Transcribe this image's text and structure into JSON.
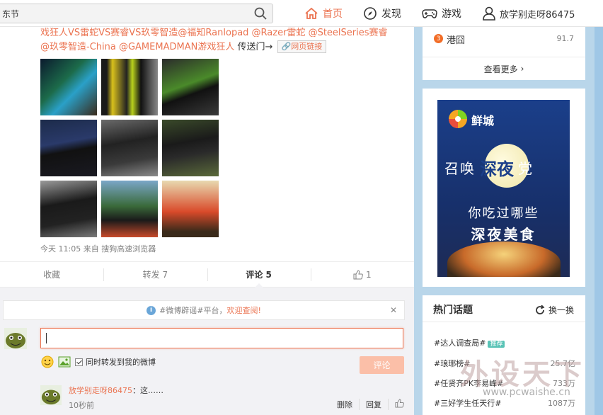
{
  "search": {
    "value": "东节"
  },
  "nav": {
    "home": "首页",
    "find": "发现",
    "game": "游戏",
    "user": "放学别走呀86475"
  },
  "post": {
    "line1": "戏狂人VS雷蛇VS赛睿VS玖零智造@福知Ranlopad @Razer雷蛇 @SteelSeries赛睿",
    "mention1": "@玖零智造-China",
    "mention2": "@GAMEMADMAN游戏狂人",
    "link_lead": "传送门→",
    "weblink": "网页链接",
    "meta": "今天 11:05 来自 搜狗高速浏览器"
  },
  "actions": {
    "fav": "收藏",
    "repost": "转发 7",
    "comment": "评论 5",
    "like": "1"
  },
  "comment": {
    "notice_tag": "#微博辟谣#平台，",
    "notice_link": "欢迎查阅!",
    "repost_label": "同时转发到我的微博",
    "submit": "评论",
    "item_user": "放学别走呀86475",
    "item_text": "：这……",
    "item_time": "10秒前",
    "delete": "删除",
    "reply": "回复"
  },
  "hot_search": {
    "rank": "3",
    "name": "港囧",
    "value": "91.7",
    "more": "查看更多"
  },
  "ad": {
    "brand": "鲜城",
    "line1": "召唤",
    "line1_big": "深夜",
    "line1_end": "党",
    "line2": "你吃过哪些",
    "line3": "深夜美食"
  },
  "topics": {
    "title": "热门话题",
    "refresh": "换一换",
    "recommend": "推荐",
    "items": [
      {
        "name": "#达人调查局#",
        "value": ""
      },
      {
        "name": "#琅琊榜#",
        "value": "25.7亿"
      },
      {
        "name": "#任贤齐PK李易峰#",
        "value": "733万"
      },
      {
        "name": "#三好学生任天行#",
        "value": "1087万"
      }
    ]
  },
  "watermark": {
    "big": "外设天下",
    "url": "www.pcwaishe.cn"
  },
  "colors": {
    "accent": "#eb7350",
    "bg": "#b9d6ea"
  }
}
